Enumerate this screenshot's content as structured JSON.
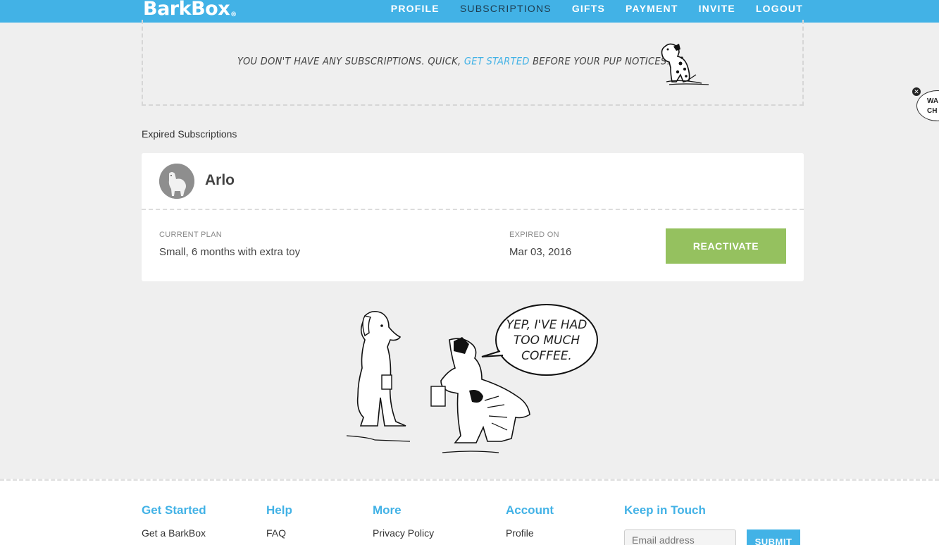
{
  "header": {
    "logo": "BarkBox",
    "logo_mark": "®",
    "nav": [
      {
        "label": "PROFILE"
      },
      {
        "label": "SUBSCRIPTIONS"
      },
      {
        "label": "GIFTS"
      },
      {
        "label": "PAYMENT"
      },
      {
        "label": "INVITE"
      },
      {
        "label": "LOGOUT"
      }
    ]
  },
  "empty_state": {
    "before": "You don't have any subscriptions. Quick,",
    "link": "get started",
    "after": "before your pup notices!"
  },
  "expired": {
    "section_title": "Expired Subscriptions",
    "pet_name": "Arlo",
    "plan_label": "CURRENT PLAN",
    "plan_value": "Small, 6 months with extra toy",
    "expired_label": "EXPIRED ON",
    "expired_value": "Mar 03, 2016",
    "reactivate_label": "REACTIVATE"
  },
  "cartoon": {
    "bubble_text": "YEP, I'VE HAD TOO MUCH COFFEE."
  },
  "side_bubble": {
    "text": "WA\nCH"
  },
  "footer": {
    "columns": [
      {
        "title": "Get Started",
        "links": [
          "Get a BarkBox"
        ]
      },
      {
        "title": "Help",
        "links": [
          "FAQ"
        ]
      },
      {
        "title": "More",
        "links": [
          "Privacy Policy"
        ]
      },
      {
        "title": "Account",
        "links": [
          "Profile"
        ]
      },
      {
        "title": "Keep in Touch",
        "links": []
      }
    ],
    "email_placeholder": "Email address",
    "submit_label": "SUBMIT"
  },
  "colors": {
    "brand_blue": "#42b2e6",
    "reactivate_green": "#95c15f",
    "background": "#efefef"
  }
}
